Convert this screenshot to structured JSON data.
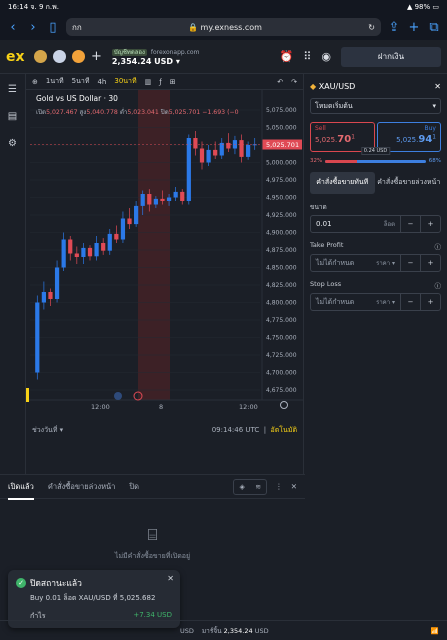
{
  "status": {
    "time": "16:14",
    "date": "จ. 9 ก.พ.",
    "battery": "98%"
  },
  "browser": {
    "aa": "กก",
    "url": "my.exness.com"
  },
  "header": {
    "logo": "ex",
    "account_type": "บัญชีทดลอง",
    "account_server": "forexonapp.com",
    "balance": "2,354.24 USD",
    "deposit_label": "ฝากเงิน"
  },
  "toolbar": {
    "timeframes": [
      "1นาที",
      "5นาที",
      "4h",
      "30นาที"
    ],
    "active_timeframe": "30นาที"
  },
  "chart": {
    "title": "Gold vs US Dollar · 30",
    "ohlc": {
      "o_label": "เปิด",
      "o": "5,027.467",
      "h_label": "สูง",
      "h": "5,040.778",
      "l_label": "ต่ำ",
      "l": "5,023.041",
      "c_label": "ปิด",
      "c": "5,025.701",
      "chg": "−1.693 (−0"
    },
    "range_label": "ช่วงวันที่",
    "time_label": "09:14:46 UTC",
    "auto_label": "อัตโนมัติ",
    "current_price": "5,025.701"
  },
  "chart_data": {
    "type": "candlestick",
    "title": "Gold vs US Dollar · 30",
    "ylim": [
      4675,
      5075
    ],
    "y_ticks": [
      "5,075.000",
      "5,050.000",
      "5,025.000",
      "5,000.000",
      "4,975.000",
      "4,950.000",
      "4,925.000",
      "4,900.000",
      "4,875.000",
      "4,850.000",
      "4,825.000",
      "4,800.000",
      "4,775.000",
      "4,750.000",
      "4,725.000",
      "4,700.000",
      "4,675.000"
    ],
    "x_ticks": [
      "12:00",
      "8",
      "12:00"
    ],
    "candles": [
      [
        4700,
        4810,
        4690,
        4800
      ],
      [
        4800,
        4830,
        4790,
        4815
      ],
      [
        4815,
        4820,
        4795,
        4805
      ],
      [
        4805,
        4860,
        4800,
        4850
      ],
      [
        4850,
        4900,
        4845,
        4890
      ],
      [
        4890,
        4895,
        4860,
        4870
      ],
      [
        4870,
        4880,
        4855,
        4865
      ],
      [
        4865,
        4885,
        4855,
        4878
      ],
      [
        4878,
        4882,
        4860,
        4866
      ],
      [
        4866,
        4895,
        4860,
        4885
      ],
      [
        4885,
        4892,
        4868,
        4874
      ],
      [
        4874,
        4905,
        4868,
        4898
      ],
      [
        4898,
        4910,
        4885,
        4890
      ],
      [
        4890,
        4930,
        4885,
        4920
      ],
      [
        4920,
        4935,
        4905,
        4912
      ],
      [
        4912,
        4945,
        4908,
        4938
      ],
      [
        4938,
        4960,
        4925,
        4955
      ],
      [
        4955,
        4962,
        4930,
        4940
      ],
      [
        4940,
        4952,
        4935,
        4948
      ],
      [
        4948,
        4960,
        4940,
        4945
      ],
      [
        4945,
        4955,
        4938,
        4950
      ],
      [
        4950,
        4965,
        4945,
        4958
      ],
      [
        4958,
        4962,
        4940,
        4945
      ],
      [
        4945,
        5040,
        4940,
        5035
      ],
      [
        5035,
        5045,
        5010,
        5020
      ],
      [
        5020,
        5030,
        4990,
        5000
      ],
      [
        5000,
        5025,
        4995,
        5018
      ],
      [
        5018,
        5030,
        5005,
        5010
      ],
      [
        5010,
        5035,
        5005,
        5028
      ],
      [
        5028,
        5042,
        5015,
        5020
      ],
      [
        5020,
        5038,
        5012,
        5032
      ],
      [
        5032,
        5040,
        5000,
        5008
      ],
      [
        5008,
        5030,
        5004,
        5025
      ],
      [
        5025,
        5035,
        5018,
        5026
      ]
    ]
  },
  "panel": {
    "symbol": "XAU/USD",
    "mode": "โหมดเริ่มต้น",
    "sell_label": "Sell",
    "sell_price_small": "5,025.",
    "sell_price_big": "70",
    "sell_sup": "1",
    "buy_label": "Buy",
    "buy_price_small": "5,025.",
    "buy_price_big": "94",
    "buy_sup": "1",
    "spread": "0.24 USD",
    "sell_pct": "32%",
    "buy_pct": "68%",
    "sell_fraction": 0.32,
    "tab_market": "คำสั่งซื้อขายทันที",
    "tab_pending": "คำสั่งซื้อขายล่วงหน้า",
    "volume_label": "ขนาด",
    "volume_value": "0.01",
    "volume_unit": "ล็อต",
    "tp_label": "Take Profit",
    "tp_value": "ไม่ได้กำหนด",
    "tp_unit": "ราคา",
    "sl_label": "Stop Loss",
    "sl_value": "ไม่ได้กำหนด",
    "sl_unit": "ราคา"
  },
  "bottom": {
    "tab_open": "เปิดแล้ว",
    "tab_pending": "คำสั่งซื้อขายล่วงหน้า",
    "tab_closed": "ปิด",
    "empty_text": "ไม่มีคำสั่งซื้อขายที่เปิดอยู่"
  },
  "toast": {
    "title": "ปิดสถานะแล้ว",
    "detail": "Buy 0.01 ล็อต XAU/USD ที่ 5,025.682",
    "profit_label": "กำไร",
    "profit_value": "+7.34 USD"
  },
  "footer": {
    "currency": "USD",
    "equity_label": "มาร์จิ้น",
    "equity_value": "2,354.24",
    "equity_currency": "USD"
  }
}
